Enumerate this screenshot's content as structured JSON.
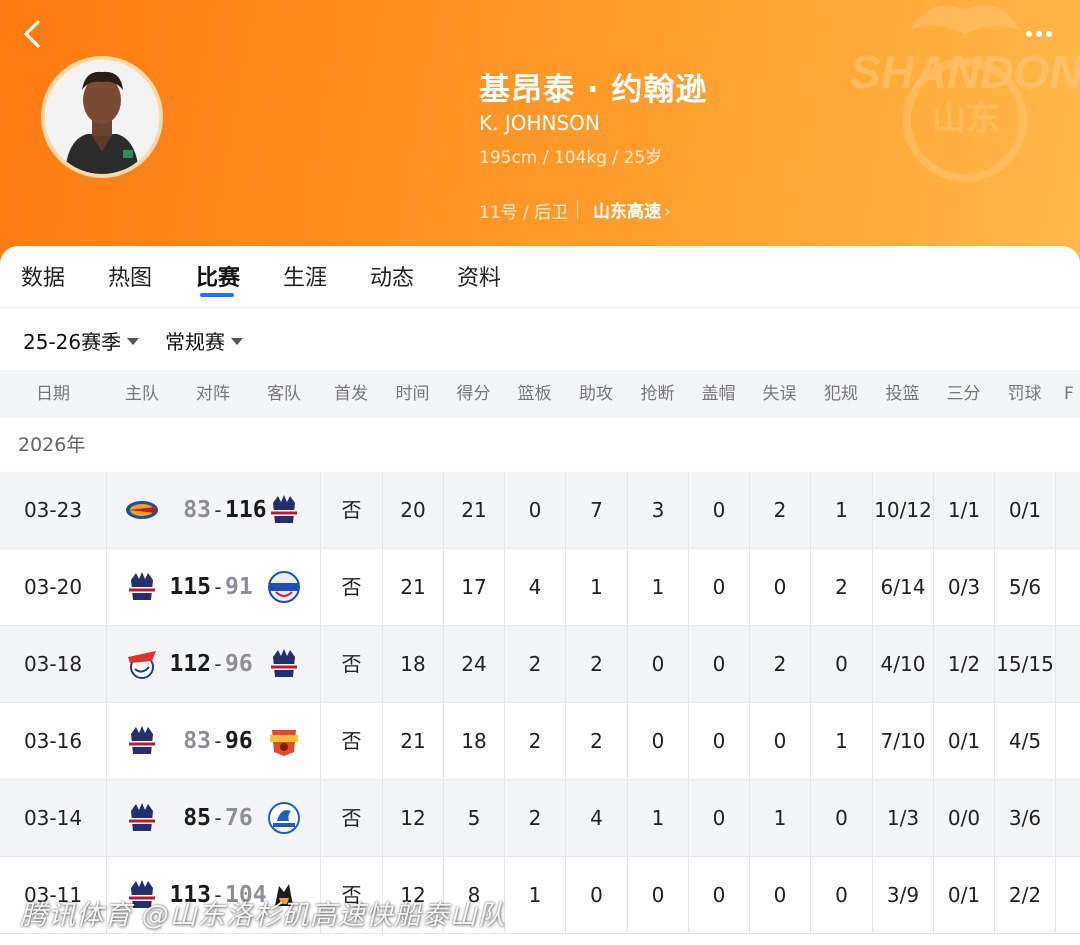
{
  "player": {
    "name_cn": "基昂泰 · 约翰逊",
    "name_en": "K. JOHNSON",
    "bio": "195cm / 104kg / 25岁",
    "number_position": "11号 / 后卫",
    "team": "山东高速",
    "team_link_chevron": "›"
  },
  "header": {
    "back_icon": "chevron-left-icon",
    "more_icon": "more-dots-icon",
    "watermark_text": "SHANDONG",
    "watermark_cn": "山东"
  },
  "tabs": [
    {
      "label": "数据",
      "active": false
    },
    {
      "label": "热图",
      "active": false
    },
    {
      "label": "比赛",
      "active": true
    },
    {
      "label": "生涯",
      "active": false
    },
    {
      "label": "动态",
      "active": false
    },
    {
      "label": "资料",
      "active": false
    }
  ],
  "filters": {
    "season": "25-26赛季",
    "type": "常规赛"
  },
  "columns": [
    "日期",
    "主队",
    "对阵",
    "客队",
    "首发",
    "时间",
    "得分",
    "篮板",
    "助攻",
    "抢断",
    "盖帽",
    "失误",
    "犯规",
    "投篮",
    "三分",
    "罚球",
    "F"
  ],
  "season_label": "2026年",
  "games": [
    {
      "date": "03-23",
      "home_logo": "beijing-logo",
      "away_logo": "shandong-logo",
      "home_score": "83",
      "away_score": "116",
      "winner": "away",
      "starter": "否",
      "minutes": "20",
      "points": "21",
      "rebounds": "0",
      "assists": "7",
      "steals": "3",
      "blocks": "0",
      "turnovers": "2",
      "fouls": "1",
      "fg": "10/12",
      "three": "1/1",
      "ft": "0/1"
    },
    {
      "date": "03-20",
      "home_logo": "shandong-logo",
      "away_logo": "pioneers-logo",
      "home_score": "115",
      "away_score": "91",
      "winner": "home",
      "starter": "否",
      "minutes": "21",
      "points": "17",
      "rebounds": "4",
      "assists": "1",
      "steals": "1",
      "blocks": "0",
      "turnovers": "0",
      "fouls": "2",
      "fg": "6/14",
      "three": "0/3",
      "ft": "5/6"
    },
    {
      "date": "03-18",
      "home_logo": "sharks-logo",
      "away_logo": "shandong-logo",
      "home_score": "112",
      "away_score": "96",
      "winner": "home",
      "starter": "否",
      "minutes": "18",
      "points": "24",
      "rebounds": "2",
      "assists": "2",
      "steals": "0",
      "blocks": "0",
      "turnovers": "2",
      "fouls": "0",
      "fg": "4/10",
      "three": "1/2",
      "ft": "15/15"
    },
    {
      "date": "03-16",
      "home_logo": "shandong-logo",
      "away_logo": "leopards-logo",
      "home_score": "83",
      "away_score": "96",
      "winner": "away",
      "starter": "否",
      "minutes": "21",
      "points": "18",
      "rebounds": "2",
      "assists": "2",
      "steals": "0",
      "blocks": "0",
      "turnovers": "0",
      "fouls": "1",
      "fg": "7/10",
      "three": "0/1",
      "ft": "4/5"
    },
    {
      "date": "03-14",
      "home_logo": "shandong-logo",
      "away_logo": "qingdao-logo",
      "home_score": "85",
      "away_score": "76",
      "winner": "home",
      "starter": "否",
      "minutes": "12",
      "points": "5",
      "rebounds": "2",
      "assists": "4",
      "steals": "1",
      "blocks": "0",
      "turnovers": "1",
      "fouls": "0",
      "fg": "1/3",
      "three": "0/0",
      "ft": "3/6"
    },
    {
      "date": "03-11",
      "home_logo": "shandong-logo",
      "away_logo": "guangsha-logo",
      "home_score": "113",
      "away_score": "104",
      "winner": "home",
      "starter": "否",
      "minutes": "12",
      "points": "8",
      "rebounds": "1",
      "assists": "0",
      "steals": "0",
      "blocks": "0",
      "turnovers": "0",
      "fouls": "0",
      "fg": "3/9",
      "three": "0/1",
      "ft": "2/2"
    }
  ],
  "footer_watermark": "腾讯体育 @山东洛杉矶高速快船泰山队",
  "colors": {
    "header_start": "#ff7a12",
    "header_end": "#ffb84a",
    "tab_indicator": "#1976ff",
    "row_alt": "#f4f5f7"
  }
}
